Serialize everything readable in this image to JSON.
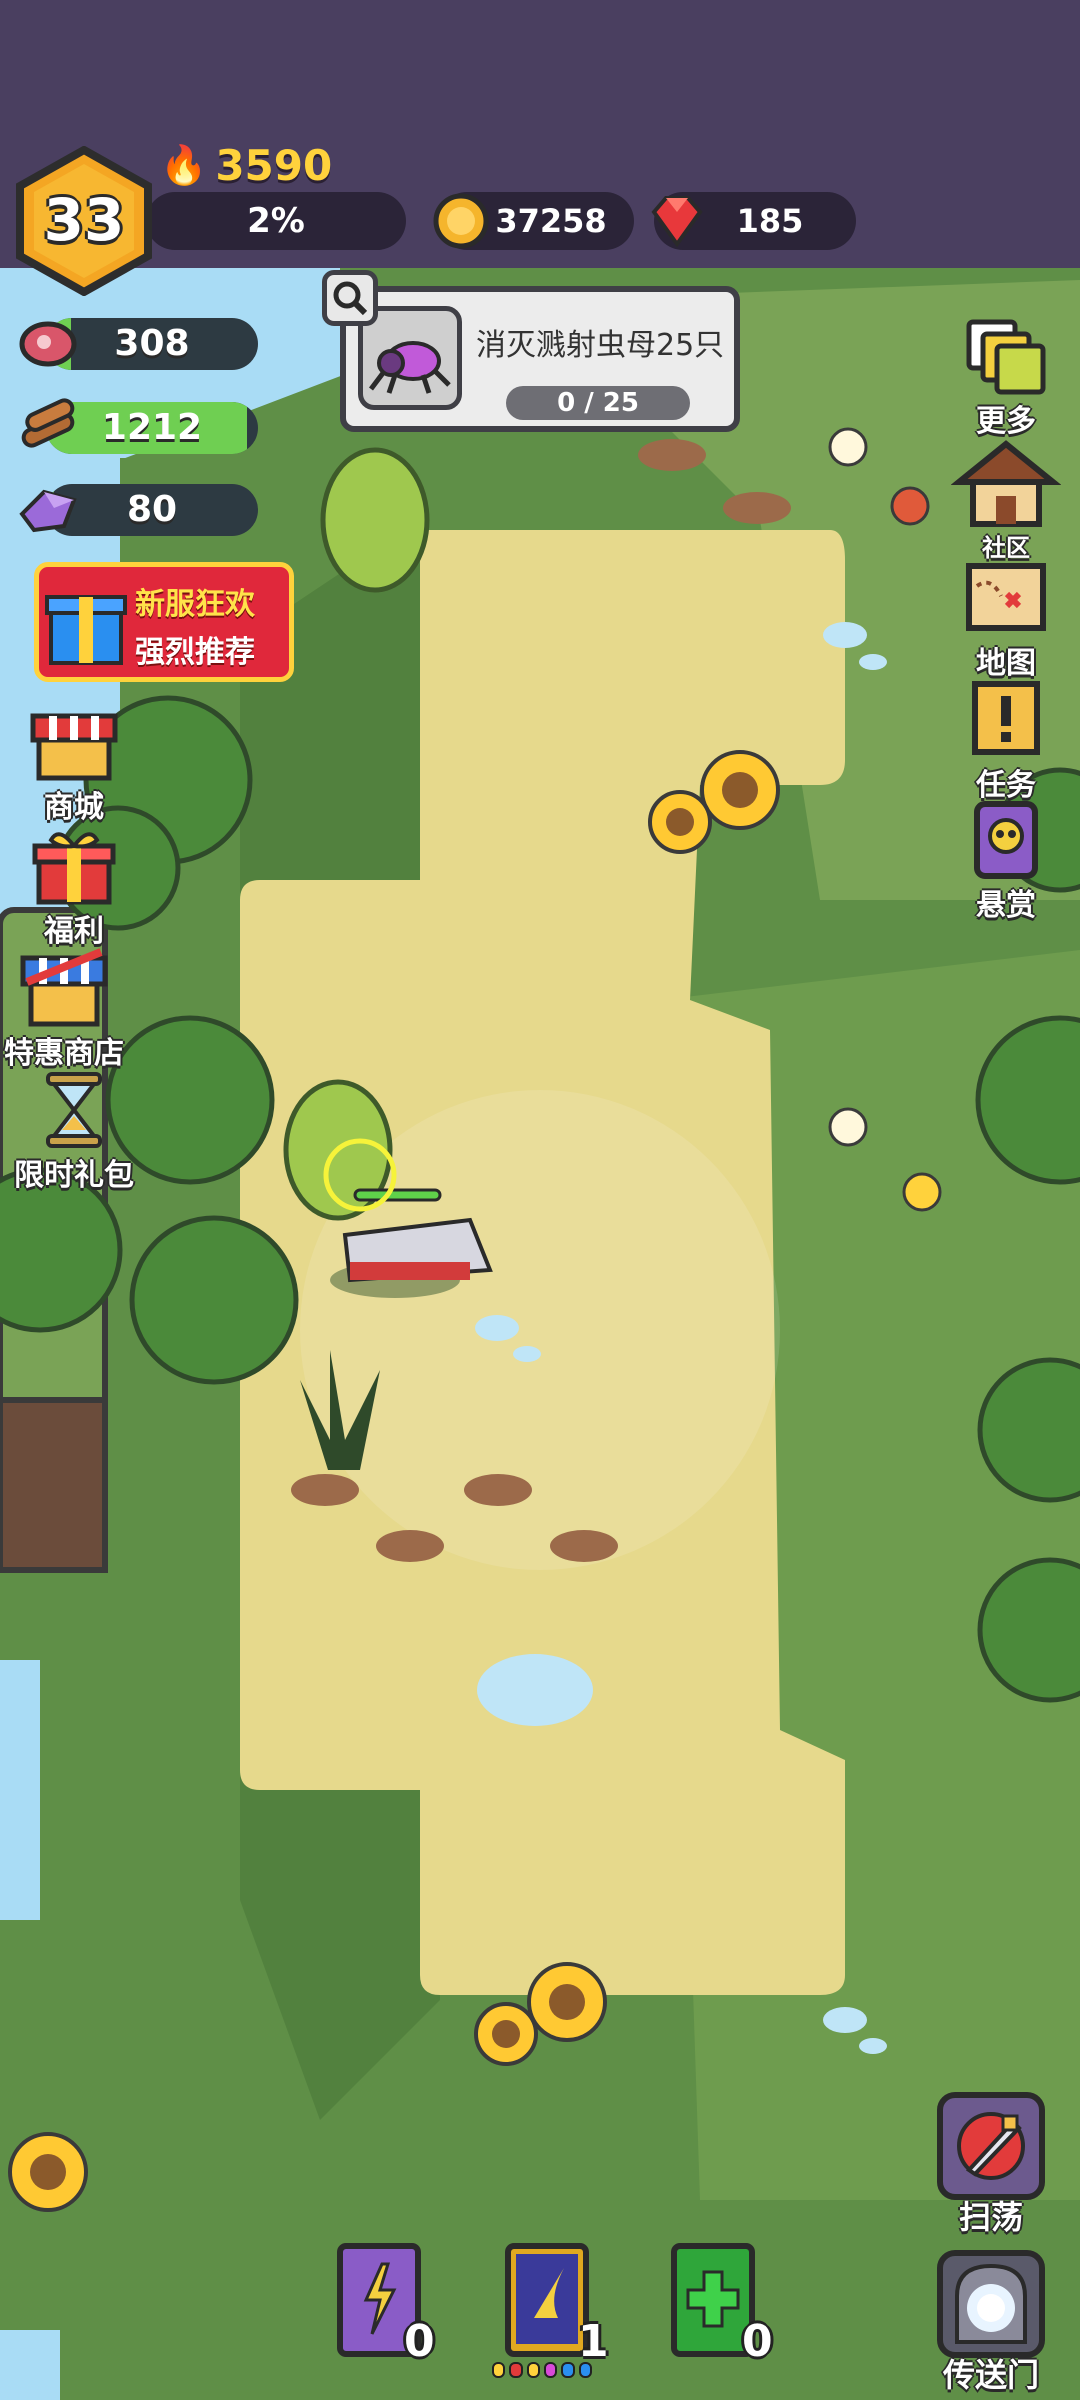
{
  "player": {
    "level": "33",
    "power": "3590",
    "xp_percent": "2%",
    "xp_fraction": 0.02
  },
  "currencies": {
    "gold": "37258",
    "gems": "185"
  },
  "resources": [
    {
      "name": "meat",
      "value": "308",
      "fill": 0.12
    },
    {
      "name": "wood",
      "value": "1212",
      "fill": 0.95
    },
    {
      "name": "crystal",
      "value": "80",
      "fill": 0.04
    }
  ],
  "quest": {
    "title": "消灭溅射虫母25只",
    "progress": "0 / 25"
  },
  "promo": {
    "line1": "新服狂欢",
    "line2": "强烈推荐"
  },
  "left_menu": {
    "shop": "商城",
    "welfare": "福利",
    "special_shop": "特惠商店",
    "limited_pack": "限时礼包"
  },
  "right_menu": {
    "more": "更多",
    "community": "社区",
    "map": "地图",
    "tasks": "任务",
    "bounty": "悬赏"
  },
  "bottom": {
    "books": [
      {
        "name": "lightning-book",
        "count": "0",
        "color": "#8a5cc7"
      },
      {
        "name": "wind-book",
        "count": "1",
        "color": "#e0a820"
      },
      {
        "name": "heal-book",
        "count": "0",
        "color": "#2fa63a"
      }
    ],
    "sweep": "扫荡",
    "portal": "传送门"
  },
  "colors": {
    "topbar": "#4a3f60",
    "grass": "#5f8f47",
    "path": "#e6d98c",
    "accent": "#ffcf3a"
  }
}
